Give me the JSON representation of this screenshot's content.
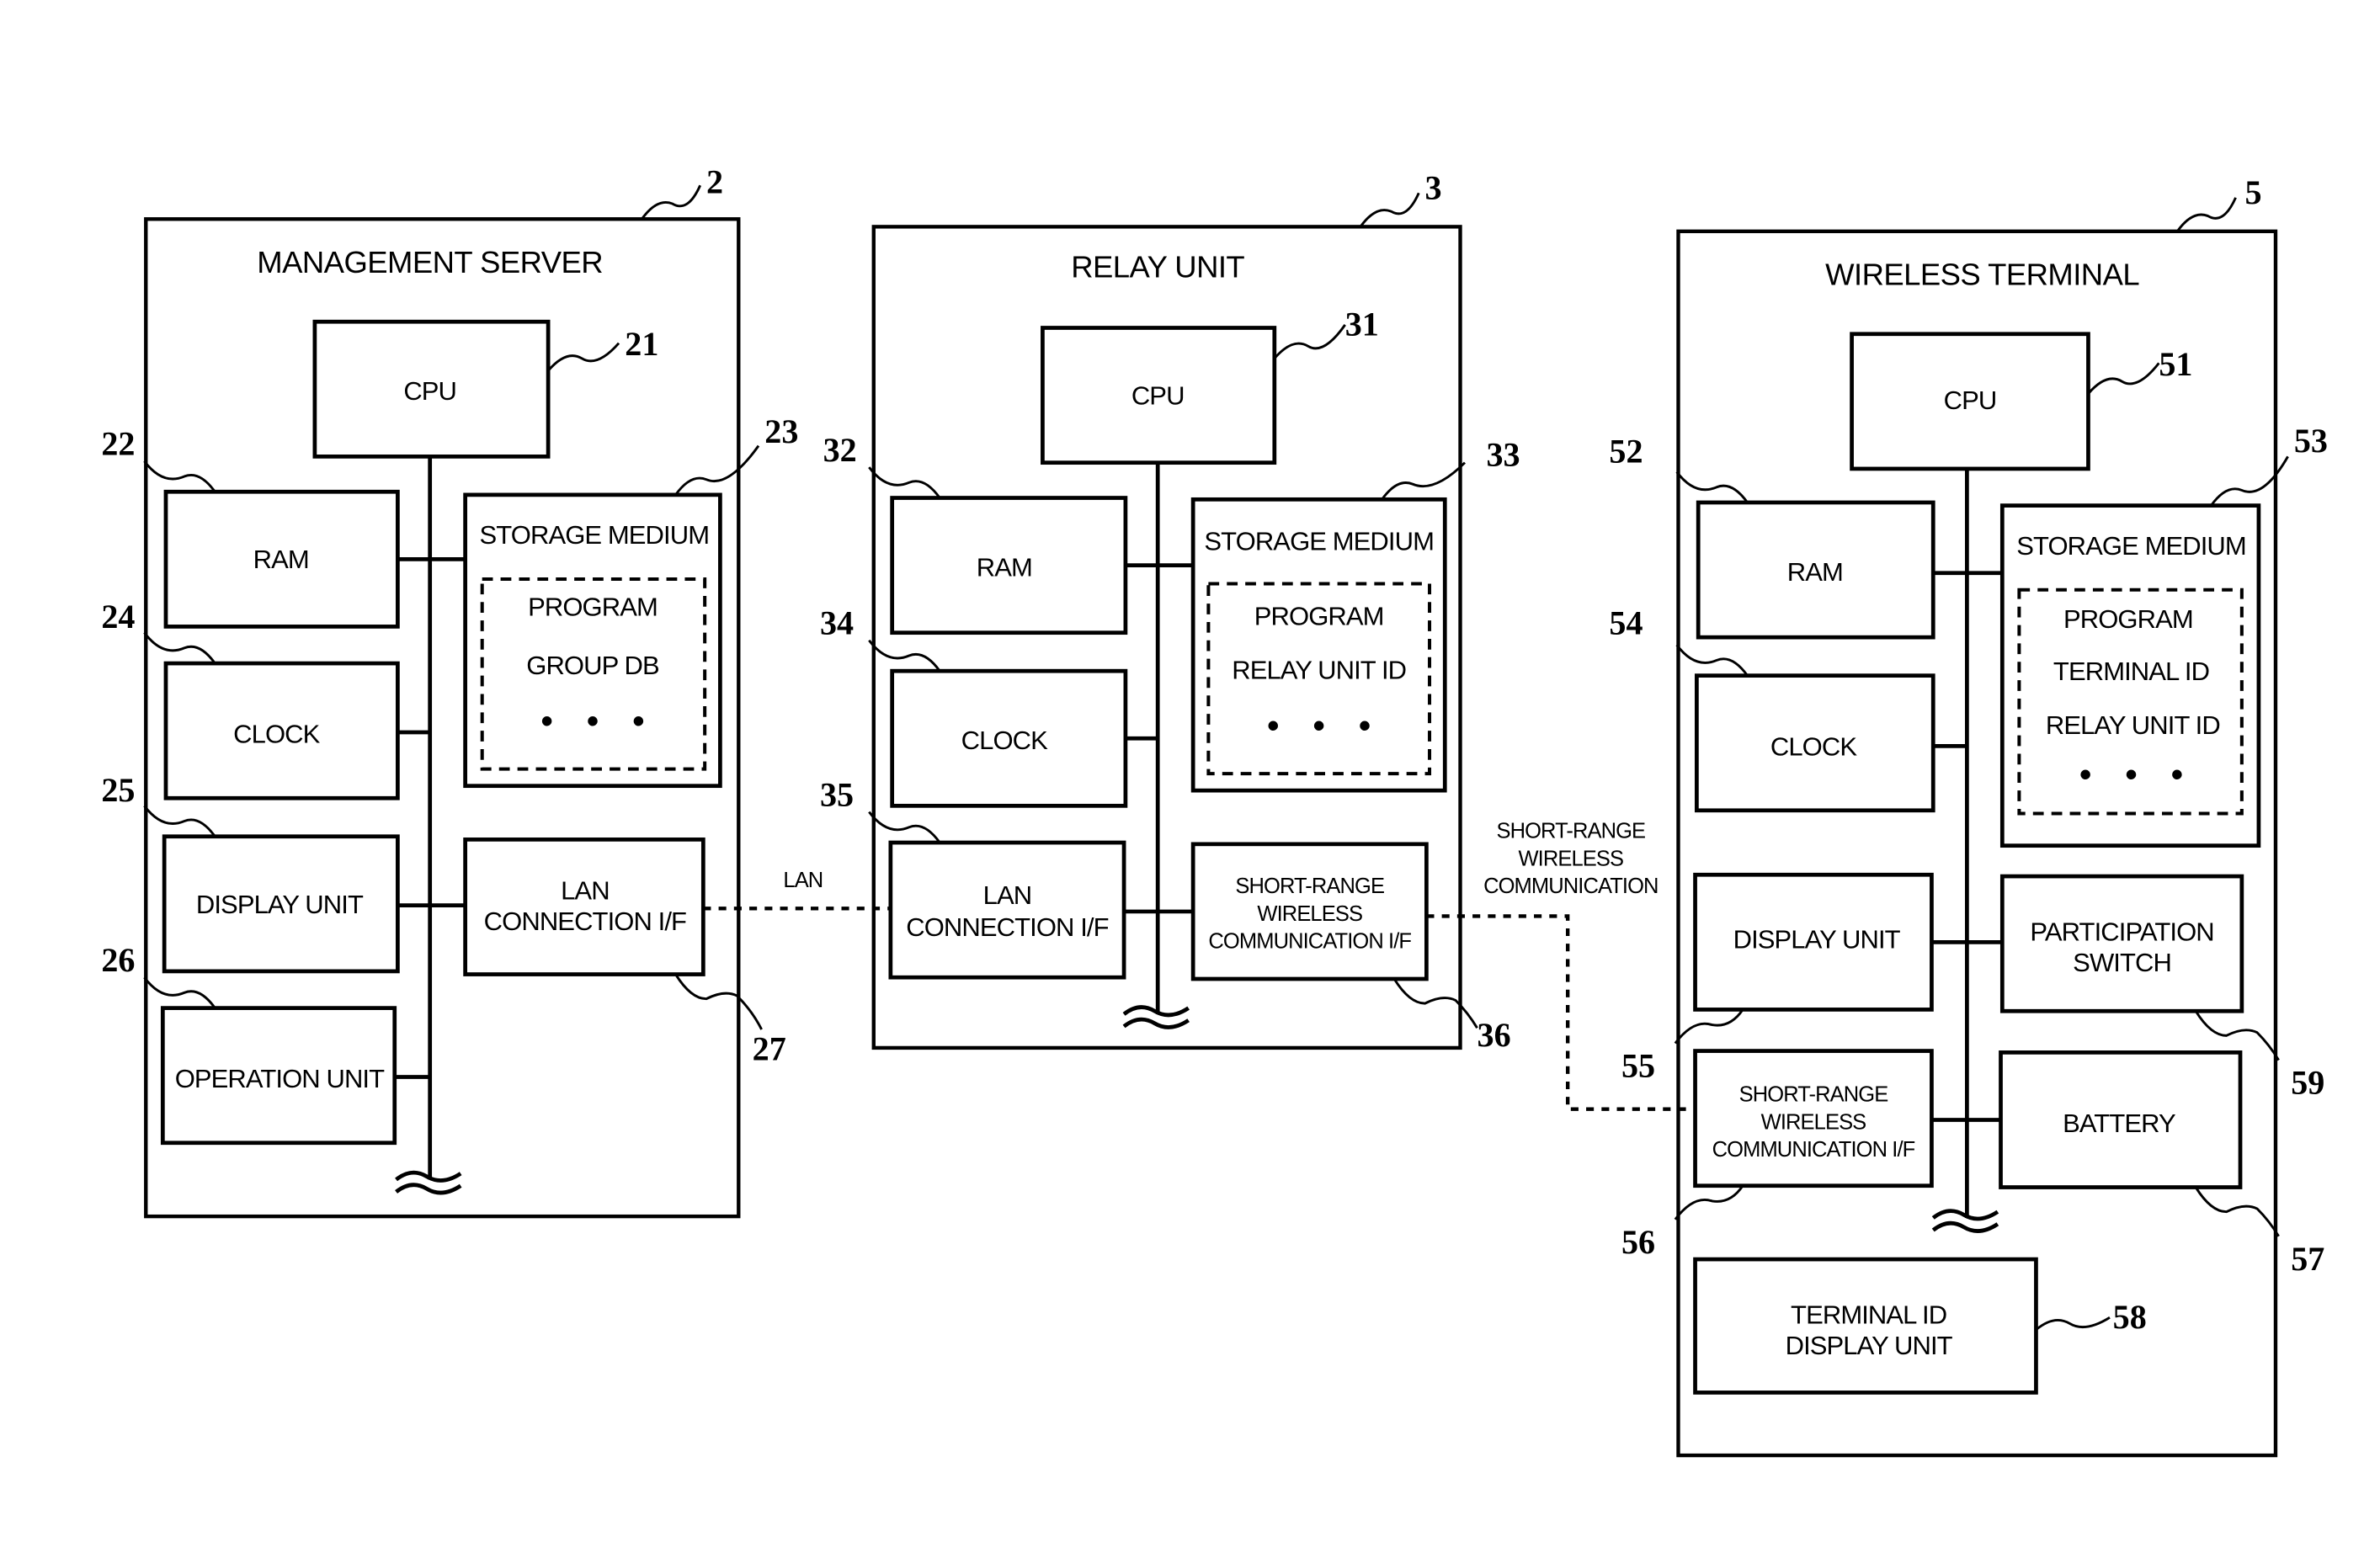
{
  "figure": {
    "links": {
      "lan_label": "LAN",
      "short_range_label": [
        "SHORT-RANGE",
        "WIRELESS",
        "COMMUNICATION"
      ]
    },
    "management_server": {
      "ref": "2",
      "title": "MANAGEMENT SERVER",
      "cpu": {
        "label": "CPU",
        "ref": "21"
      },
      "ram": {
        "label": "RAM",
        "ref": "22"
      },
      "storage": {
        "label": "STORAGE MEDIUM",
        "ref": "23",
        "contents": [
          "PROGRAM",
          "GROUP DB",
          "• • •"
        ]
      },
      "clock": {
        "label": "CLOCK",
        "ref": "24"
      },
      "display_unit": {
        "label": "DISPLAY UNIT",
        "ref": "25"
      },
      "operation_unit": {
        "label": "OPERATION UNIT",
        "ref": "26"
      },
      "lan_if": {
        "label": [
          "LAN",
          "CONNECTION I/F"
        ],
        "ref": "27"
      }
    },
    "relay_unit": {
      "ref": "3",
      "title": "RELAY UNIT",
      "cpu": {
        "label": "CPU",
        "ref": "31"
      },
      "ram": {
        "label": "RAM",
        "ref": "32"
      },
      "storage": {
        "label": "STORAGE MEDIUM",
        "ref": "33",
        "contents": [
          "PROGRAM",
          "RELAY UNIT ID",
          "• • •"
        ]
      },
      "clock": {
        "label": "CLOCK",
        "ref": "34"
      },
      "lan_if": {
        "label": [
          "LAN",
          "CONNECTION I/F"
        ],
        "ref": "35"
      },
      "short_range_if": {
        "label": [
          "SHORT-RANGE",
          "WIRELESS",
          "COMMUNICATION I/F"
        ],
        "ref": "36"
      }
    },
    "wireless_terminal": {
      "ref": "5",
      "title": "WIRELESS TERMINAL",
      "cpu": {
        "label": "CPU",
        "ref": "51"
      },
      "ram": {
        "label": "RAM",
        "ref": "52"
      },
      "storage": {
        "label": "STORAGE MEDIUM",
        "ref": "53",
        "contents": [
          "PROGRAM",
          "TERMINAL ID",
          "RELAY UNIT ID",
          "• • •"
        ]
      },
      "clock": {
        "label": "CLOCK",
        "ref": "54"
      },
      "display_unit": {
        "label": "DISPLAY UNIT",
        "ref": "55"
      },
      "short_range_if": {
        "label": [
          "SHORT-RANGE",
          "WIRELESS",
          "COMMUNICATION I/F"
        ],
        "ref": "56"
      },
      "battery": {
        "label": "BATTERY",
        "ref": "57"
      },
      "terminal_id_display": {
        "label": [
          "TERMINAL ID",
          "DISPLAY UNIT"
        ],
        "ref": "58"
      },
      "participation_switch": {
        "label": [
          "PARTICIPATION",
          "SWITCH"
        ],
        "ref": "59"
      }
    }
  }
}
